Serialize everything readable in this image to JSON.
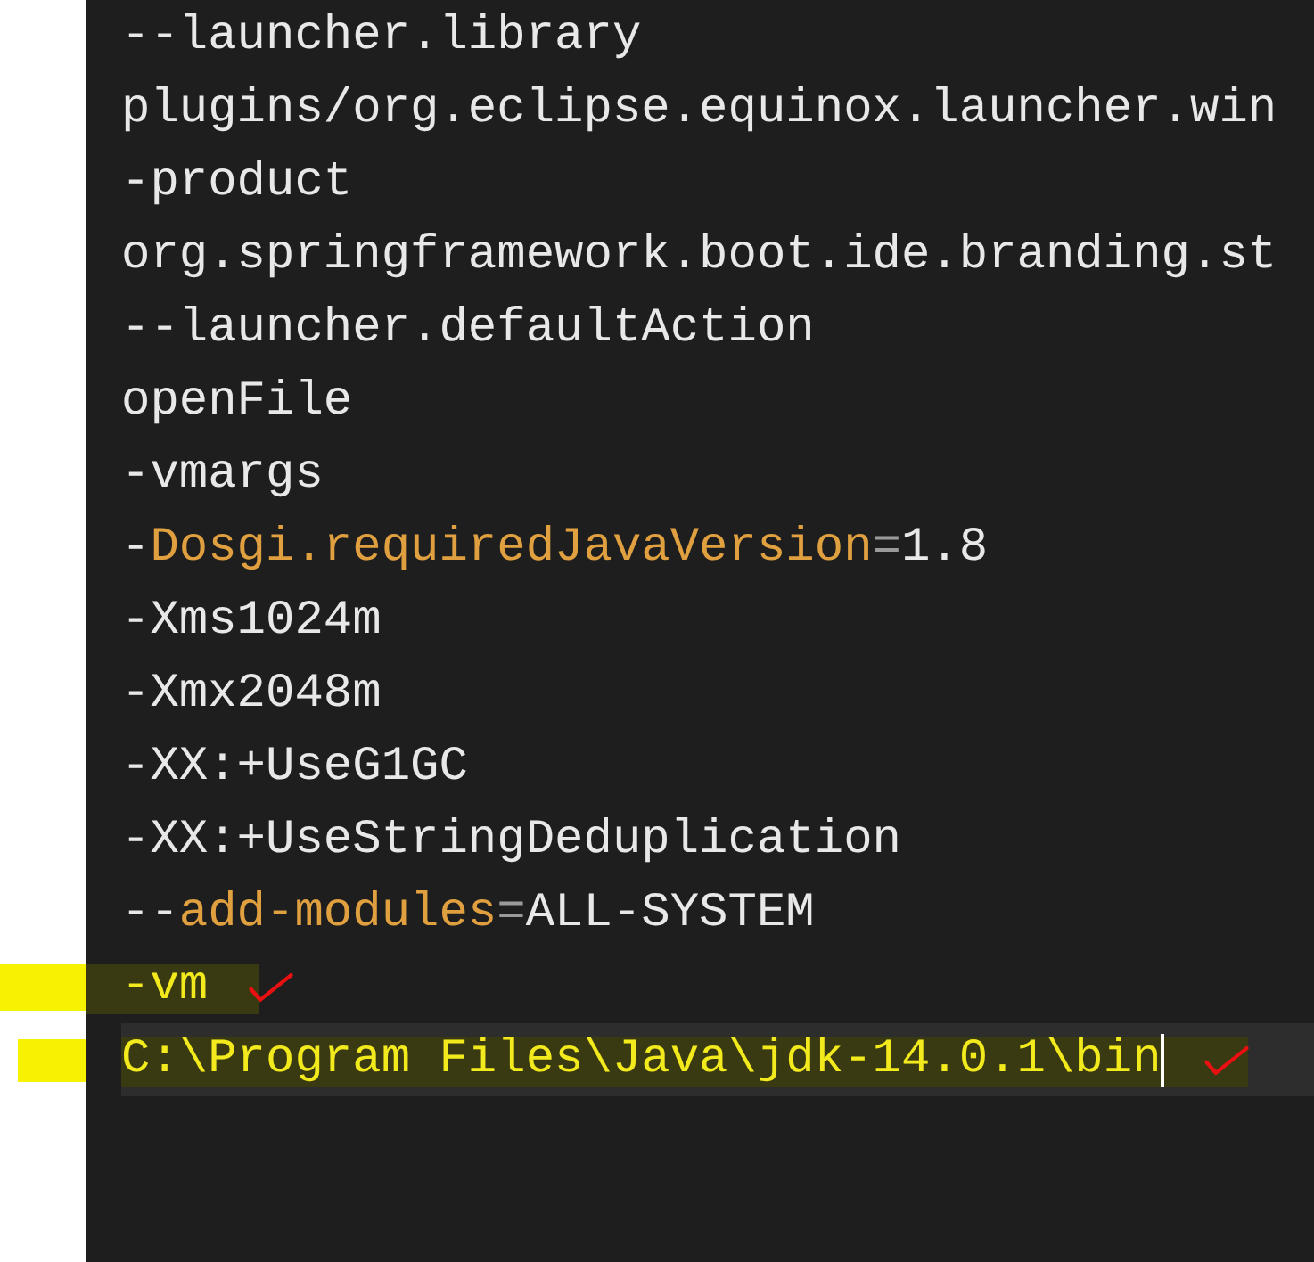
{
  "editor": {
    "lines": [
      {
        "segments": [
          {
            "kind": "plain",
            "text": "--launcher.library"
          }
        ],
        "marked": false,
        "current": false
      },
      {
        "segments": [
          {
            "kind": "plain",
            "text": "plugins/org.eclipse.equinox.launcher.win"
          }
        ],
        "marked": false,
        "current": false
      },
      {
        "segments": [
          {
            "kind": "plain",
            "text": "-product"
          }
        ],
        "marked": false,
        "current": false
      },
      {
        "segments": [
          {
            "kind": "plain",
            "text": "org.springframework.boot.ide.branding.st"
          }
        ],
        "marked": false,
        "current": false
      },
      {
        "segments": [
          {
            "kind": "plain",
            "text": "--launcher.defaultAction"
          }
        ],
        "marked": false,
        "current": false
      },
      {
        "segments": [
          {
            "kind": "plain",
            "text": "openFile"
          }
        ],
        "marked": false,
        "current": false
      },
      {
        "segments": [
          {
            "kind": "plain",
            "text": "-vmargs"
          }
        ],
        "marked": false,
        "current": false
      },
      {
        "segments": [
          {
            "kind": "plain",
            "text": "-"
          },
          {
            "kind": "key",
            "text": "Dosgi.requiredJavaVersion"
          },
          {
            "kind": "operator",
            "text": "="
          },
          {
            "kind": "plain",
            "text": "1.8"
          }
        ],
        "marked": false,
        "current": false
      },
      {
        "segments": [
          {
            "kind": "plain",
            "text": "-Xms1024m"
          }
        ],
        "marked": false,
        "current": false
      },
      {
        "segments": [
          {
            "kind": "plain",
            "text": "-Xmx2048m"
          }
        ],
        "marked": false,
        "current": false
      },
      {
        "segments": [
          {
            "kind": "plain",
            "text": "-XX:+UseG1GC"
          }
        ],
        "marked": false,
        "current": false
      },
      {
        "segments": [
          {
            "kind": "plain",
            "text": "-XX:+UseStringDeduplication"
          }
        ],
        "marked": false,
        "current": false
      },
      {
        "segments": [
          {
            "kind": "plain",
            "text": "--"
          },
          {
            "kind": "key",
            "text": "add-modules"
          },
          {
            "kind": "operator",
            "text": "="
          },
          {
            "kind": "plain",
            "text": "ALL-SYSTEM"
          }
        ],
        "marked": false,
        "current": false
      },
      {
        "segments": [
          {
            "kind": "plain",
            "text": "-vm"
          }
        ],
        "marked": true,
        "current": false
      },
      {
        "segments": [
          {
            "kind": "plain",
            "text": "C:\\Program Files\\Java\\jdk-14.0.1\\bin"
          }
        ],
        "marked": true,
        "current": true
      }
    ]
  }
}
